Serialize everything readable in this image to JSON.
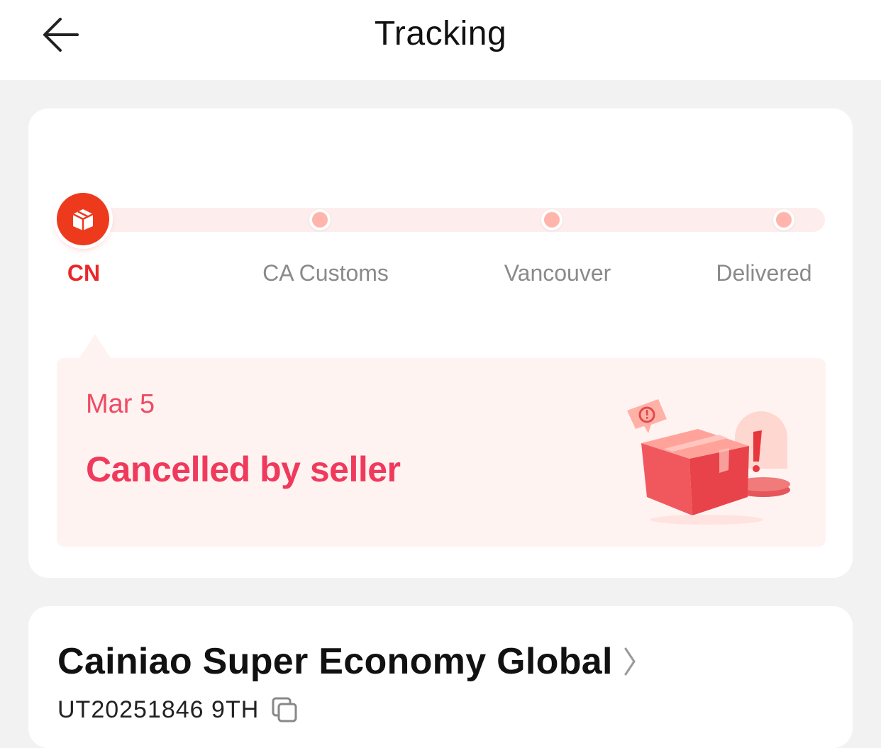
{
  "header": {
    "title": "Tracking",
    "back_icon": "arrow-left-icon"
  },
  "progress": {
    "stops": [
      {
        "label": "CN",
        "active": true
      },
      {
        "label": "CA Customs",
        "active": false
      },
      {
        "label": "Vancouver",
        "active": false
      },
      {
        "label": "Delivered",
        "active": false
      }
    ],
    "current_icon": "package-icon"
  },
  "status": {
    "date": "Mar 5",
    "text": "Cancelled by seller",
    "illustration": "cancelled-package-illustration"
  },
  "shipment": {
    "carrier": "Cainiao Super Economy Global",
    "tracking_number": "UT20251846 9TH",
    "copy_icon": "copy-icon"
  },
  "colors": {
    "accent": "#ee3a1c",
    "status_text": "#ef3a5c",
    "pending_dot": "#ffb5ab",
    "status_bg": "#fff3f2"
  }
}
